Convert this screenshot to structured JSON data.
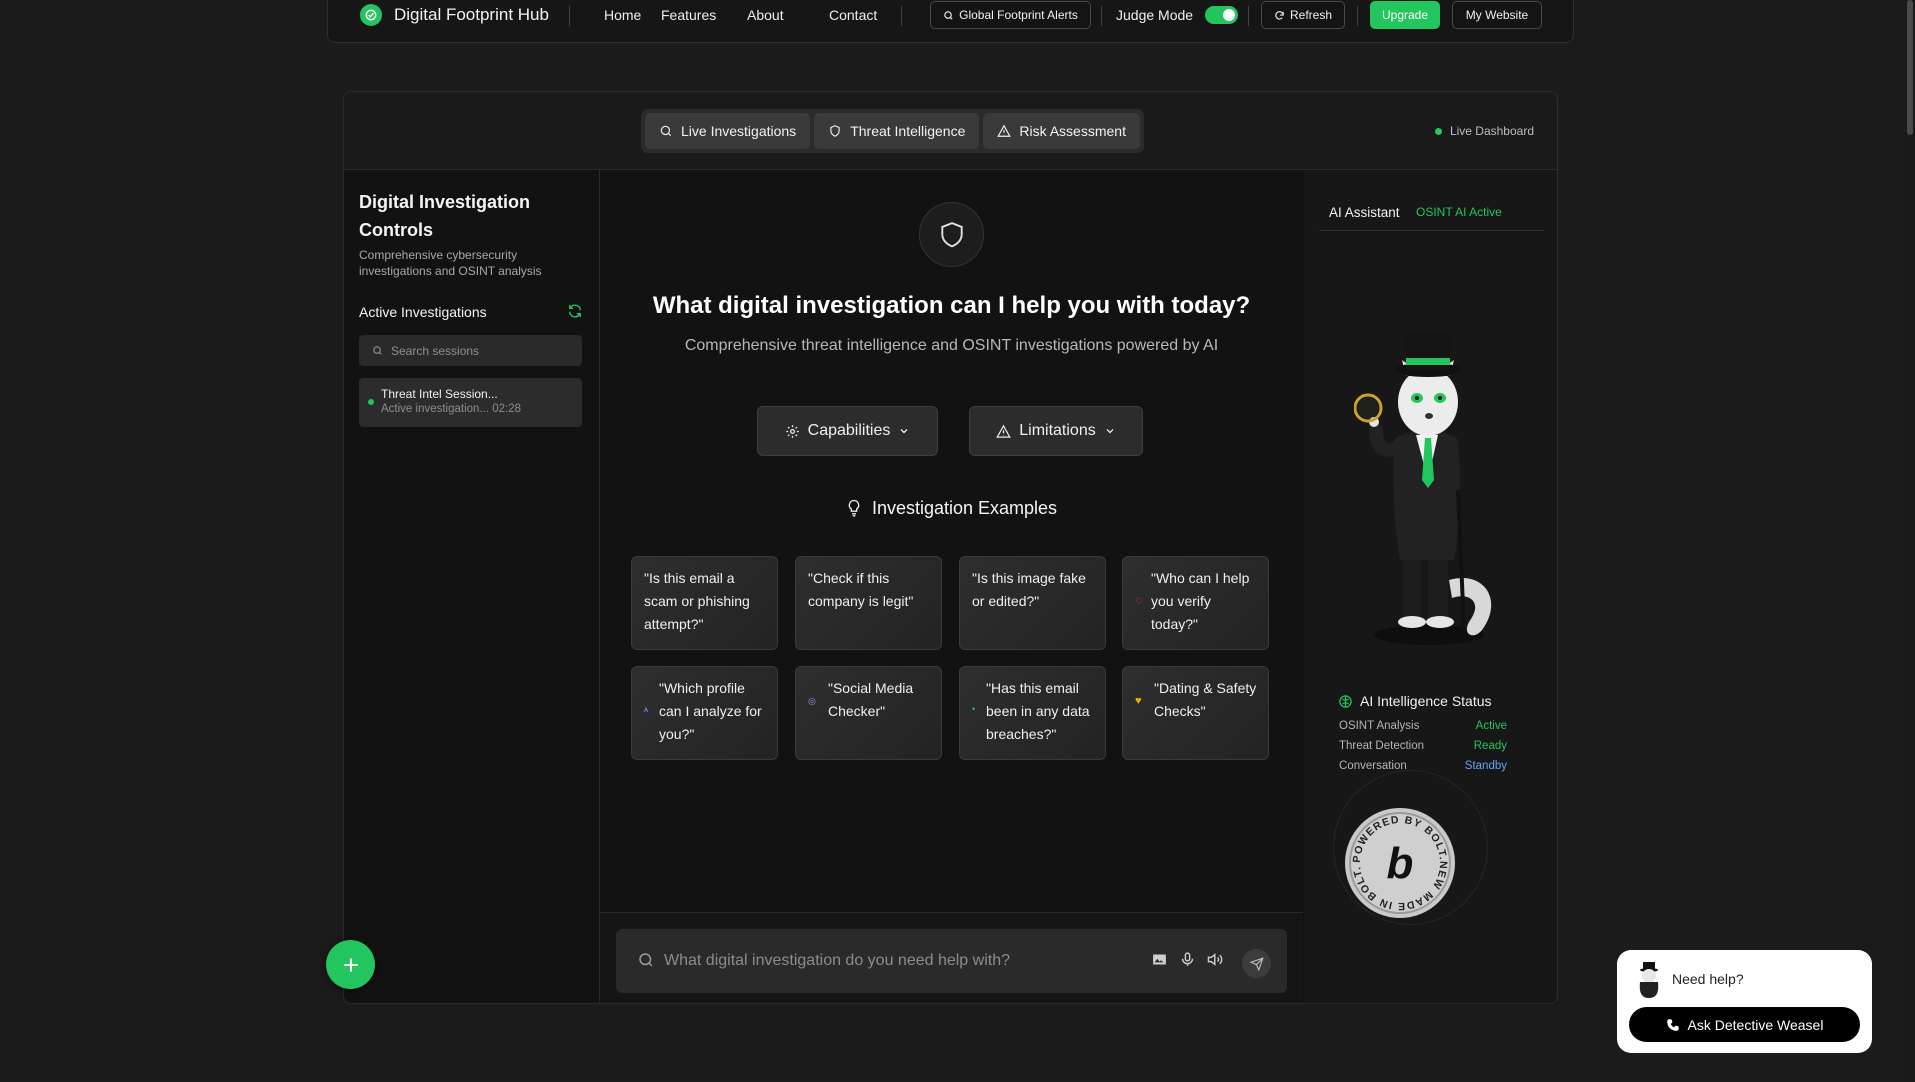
{
  "nav": {
    "brand": "Digital Footprint Hub",
    "links": [
      "Home",
      "Features",
      "About",
      "Contact"
    ],
    "alerts_label": "Global Footprint Alerts",
    "judge_label": "Judge Mode",
    "judge_on": true,
    "refresh_label": "Refresh",
    "upgrade_label": "Upgrade",
    "website_label": "My Website"
  },
  "tabs": [
    {
      "label": "Live Investigations",
      "icon": "search-icon"
    },
    {
      "label": "Threat Intelligence",
      "icon": "shield-icon"
    },
    {
      "label": "Risk Assessment",
      "icon": "warning-icon"
    }
  ],
  "live_dashboard": "Live Dashboard",
  "sidebar": {
    "title": "Digital Investigation Controls",
    "subtitle": "Comprehensive cybersecurity investigations and OSINT analysis",
    "active_label": "Active Investigations",
    "search_placeholder": "Search sessions",
    "session": {
      "name": "Threat Intel Session...",
      "meta": "Active investigation... 02:28"
    }
  },
  "main": {
    "title": "What digital investigation can I help you with today?",
    "subtitle": "Comprehensive threat intelligence and OSINT investigations powered by AI",
    "capabilities_label": "Capabilities",
    "limitations_label": "Limitations",
    "examples_title": "Investigation Examples",
    "examples": [
      "\"Is this email a scam or phishing attempt?\"",
      "\"Check if this company is legit\"",
      "\"Is this image fake or edited?\"",
      "\"Who can I help you verify today?\"",
      "\"Which profile can I analyze for you?\"",
      "\"Social Media Checker\"",
      "\"Has this email been in any data breaches?\"",
      "\"Dating & Safety Checks\""
    ],
    "input_placeholder": "What digital investigation do you need help with?"
  },
  "assistant": {
    "title": "AI Assistant",
    "status": "OSINT AI Active",
    "intel_title": "AI Intelligence Status",
    "rows": [
      {
        "label": "OSINT Analysis",
        "value": "Active",
        "color": "#22c55e"
      },
      {
        "label": "Threat Detection",
        "value": "Ready",
        "color": "#22c55e"
      },
      {
        "label": "Conversation",
        "value": "Standby",
        "color": "#60a5fa"
      }
    ],
    "badge_text": "POWERED BY BOLT.NEW MADE IN BOLT.NEW"
  },
  "help": {
    "question": "Need help?",
    "button": "Ask Detective Weasel"
  },
  "colors": {
    "accent": "#22c55e",
    "background": "#1b1b1b",
    "panel": "#121212"
  }
}
